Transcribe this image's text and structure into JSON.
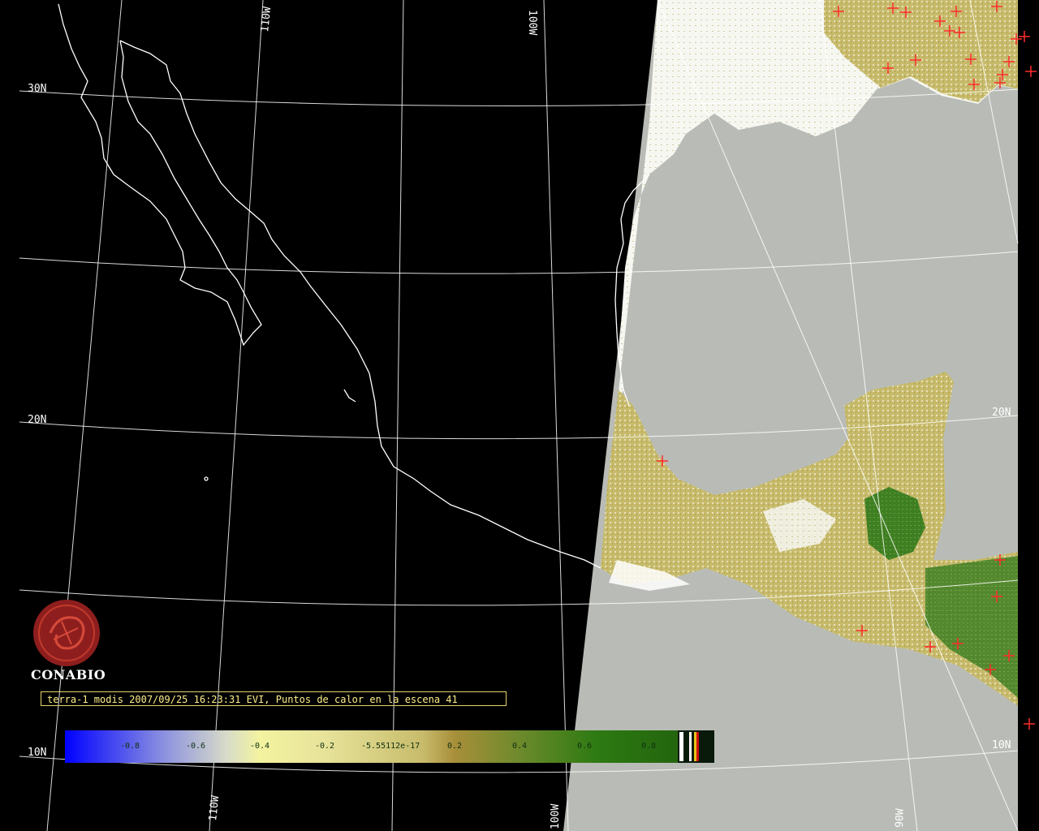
{
  "map": {
    "lat_labels": [
      "30N",
      "20N",
      "10N",
      "20N",
      "10N"
    ],
    "lon_labels": [
      "110W",
      "100W",
      "110W",
      "100W",
      "90W"
    ],
    "colors": {
      "background": "#000000",
      "coast": "#ffffff",
      "ocean_gray": "#b9bcb6",
      "land_yellow": "#c9bd6e",
      "land_green": "#3c7a22",
      "cloud_white": "#ffffff",
      "hotspot_red": "#ff2a2a",
      "grid": "#ffffff"
    }
  },
  "logo": {
    "text": "CONABIO",
    "icon": "conabio-logo-icon"
  },
  "caption": {
    "text": "terra-1 modis 2007/09/25 16:23:31 EVI, Puntos de calor en la escena 41"
  },
  "colorbar": {
    "ticks": [
      "-0.8",
      "-0.6",
      "-0.4",
      "-0.2",
      "-5.55112e-17",
      "0.2",
      "0.4",
      "0.6",
      "0.8"
    ]
  }
}
